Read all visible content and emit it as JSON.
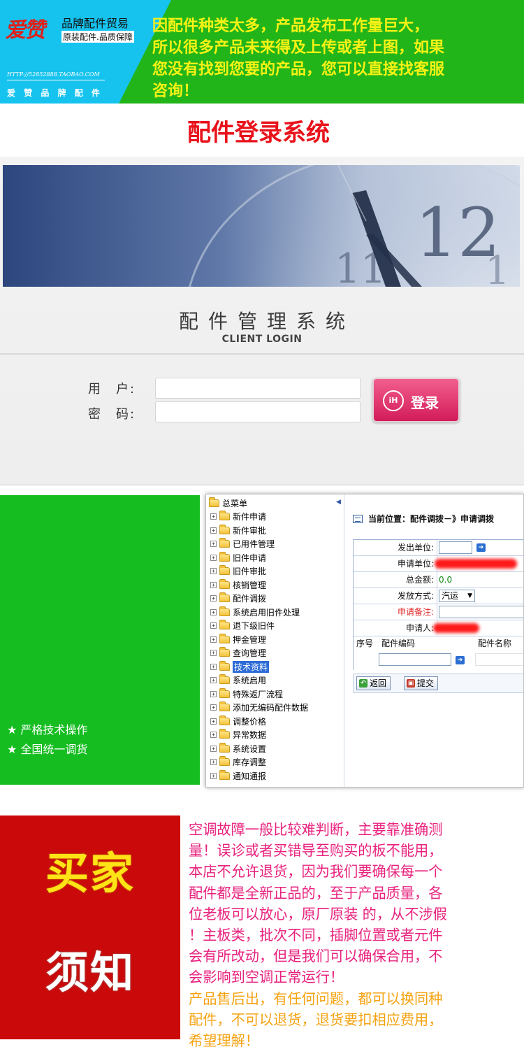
{
  "banner": {
    "logo_text": "爱赞",
    "brand_line1": "品牌配件贸易",
    "brand_line2": "原装配件.品质保障",
    "shop_url": "HTTP://52852888.TAOBAO.COM",
    "shop_name": "爱 赞 品 牌 配 件",
    "notice_lines": [
      "因配件种类太多，产品发布工作量巨大，",
      "所以很多产品未来得及上传或者上图，如果",
      "您没有找到您要的产品，您可以直接找客服",
      "咨询！"
    ]
  },
  "heading": "配件登录系统",
  "login": {
    "title": "配件管理系统",
    "subtitle": "CLIENT LOGIN",
    "user_label": "用　户:",
    "password_label": "密　码:",
    "login_button": "登录",
    "login_button_icon": "iH"
  },
  "features": [
    "★ 严格技术操作",
    "★ 全国统一调货"
  ],
  "app": {
    "tree_root": "总菜单",
    "tree_items": [
      "新件申请",
      "新件审批",
      "已用件管理",
      "旧件申请",
      "旧件审批",
      "核销管理",
      "配件调拨",
      "系统启用旧件处理",
      "退下级旧件",
      "押金管理",
      "查询管理",
      "技术资料",
      "系统启用",
      "特殊返厂流程",
      "添加无编码配件数据",
      "调整价格",
      "异常数据",
      "系统设置",
      "库存调整",
      "通知通报"
    ],
    "selected_item": "技术资料",
    "breadcrumb": "当前位置：配件调拨－》申请调拨",
    "form": {
      "issuer_label": "发出单位:",
      "applicant_unit_label": "申请单位:",
      "total_label": "总金额:",
      "total_value": "0.0",
      "method_label": "发放方式:",
      "method_value": "汽运",
      "remark_label": "申请备注:",
      "applicant_label": "申请人:"
    },
    "list_headers": [
      "序号",
      "配件编码",
      "配件名称"
    ],
    "back_button": "返回",
    "submit_button": "提交"
  },
  "notice": {
    "big_word1": "买家",
    "big_word2": "须知",
    "pink_lines": [
      "空调故障一般比较难判断，主要靠准确测",
      "量！误诊或者买错导至购买的板不能用，",
      "本店不允许退货，因为我们要确保每一个",
      "配件都是全新正品的，至于产品质量，各",
      "位老板可以放心，原厂原装 的，从不涉假",
      "！主板类，批次不同，插脚位置或者元件",
      "会有所改动，但是我们可以确保合用，不",
      "会影响到空调正常运行！"
    ],
    "orange_lines": [
      "产品售后出，有任何问题，都可以换同种",
      "配件，不可以退货，退货要扣相应费用，",
      "希望理解！"
    ]
  },
  "colors": {
    "banner_green": "#22b51a",
    "banner_cyan": "#16c3ef",
    "banner_text": "#f7f215",
    "heading_red": "#e8121b",
    "login_pink": "#d21c59",
    "feature_green": "#16bd21",
    "notice_red": "#ca0a0a",
    "notice_pink": "#e8217d",
    "notice_orange": "#f5a210"
  }
}
